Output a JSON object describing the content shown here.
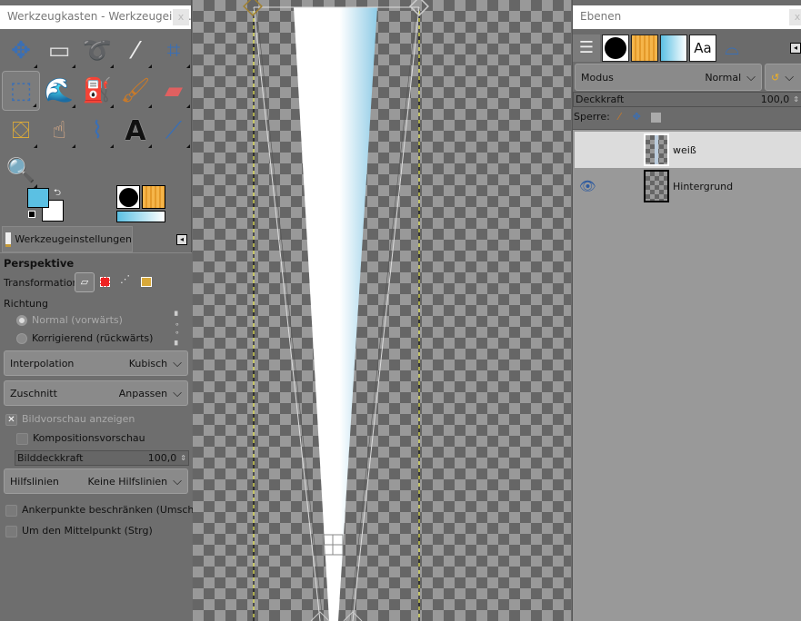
{
  "toolbox": {
    "title": "Werkzeugkasten - Werkzeugeins...",
    "close": "x",
    "tools": [
      {
        "name": "move-tool",
        "glyph": "✥",
        "color": "#3a6fb5"
      },
      {
        "name": "rect-select-tool",
        "glyph": "▭",
        "color": "#ddd"
      },
      {
        "name": "free-select-tool",
        "glyph": "➰",
        "color": "#bbb"
      },
      {
        "name": "fuzzy-select-tool",
        "glyph": "⁄",
        "color": "#eee"
      },
      {
        "name": "crop-tool",
        "glyph": "⌗",
        "color": "#3a6fb5"
      },
      {
        "name": "perspective-tool",
        "glyph": "⬚",
        "color": "#3a6fb5"
      },
      {
        "name": "warp-tool",
        "glyph": "🌊",
        "color": "#3a6fb5"
      },
      {
        "name": "bucket-fill-tool",
        "glyph": "⛽",
        "color": "#ddd"
      },
      {
        "name": "paintbrush-tool",
        "glyph": "🖌",
        "color": "#c87a2a"
      },
      {
        "name": "eraser-tool",
        "glyph": "▰",
        "color": "#e06060"
      },
      {
        "name": "clone-tool",
        "glyph": "⛋",
        "color": "#d9a93a"
      },
      {
        "name": "smudge-tool",
        "glyph": "☝",
        "color": "#e0b08a"
      },
      {
        "name": "paths-tool",
        "glyph": "⌇",
        "color": "#3a6fb5"
      },
      {
        "name": "text-tool",
        "glyph": "A",
        "color": "#111"
      },
      {
        "name": "color-picker-tool",
        "glyph": "⟋",
        "color": "#3a6fb5"
      },
      {
        "name": "zoom-tool",
        "glyph": "🔍",
        "color": "#3a6fb5"
      }
    ],
    "fg_color": "#5bc0e3",
    "bg_color": "#ffffff"
  },
  "tool_options": {
    "tab_label": "Werkzeugeinstellungen",
    "heading": "Perspektive",
    "transformation_label": "Transformation:",
    "direction_label": "Richtung",
    "direction_options": [
      "Normal (vorwärts)",
      "Korrigierend (rückwärts)"
    ],
    "interpolation": {
      "label": "Interpolation",
      "value": "Kubisch"
    },
    "clipping": {
      "label": "Zuschnitt",
      "value": "Anpassen"
    },
    "show_preview": {
      "label": "Bildvorschau anzeigen",
      "checked": true
    },
    "composited_preview": {
      "label": "Kompositionsvorschau",
      "checked": false
    },
    "image_opacity": {
      "label": "Bilddeckkraft",
      "value": "100,0"
    },
    "guides": {
      "label": "Hilfslinien",
      "value": "Keine Hilfslinien"
    },
    "constrain_handles": {
      "label": "Ankerpunkte beschränken (Umschalt)",
      "checked": false
    },
    "around_center": {
      "label": "Um den Mittelpunkt (Strg)",
      "checked": false
    }
  },
  "layers": {
    "title": "Ebenen",
    "close": "x",
    "brush_tab_text": "Aa",
    "mode": {
      "label": "Modus",
      "value": "Normal"
    },
    "opacity": {
      "label": "Deckkraft",
      "value": "100,0"
    },
    "lock_label": "Sperre:",
    "items": [
      {
        "name": "weiß",
        "visible": false,
        "selected": true
      },
      {
        "name": "Hintergrund",
        "visible": true,
        "selected": false
      }
    ]
  }
}
